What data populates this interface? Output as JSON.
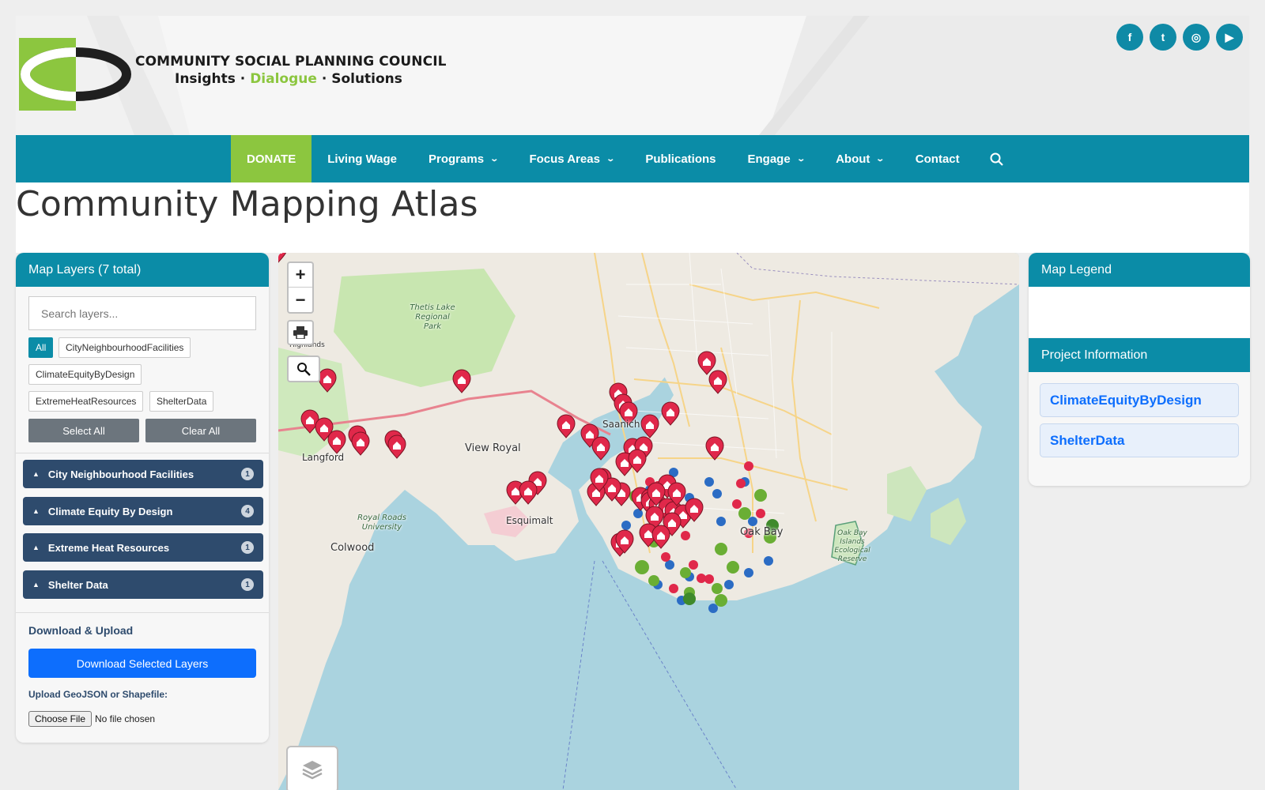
{
  "header": {
    "org_name": "COMMUNITY SOCIAL PLANNING COUNCIL",
    "tagline_part1": "Insights · ",
    "tagline_part2": "Dialogue",
    "tagline_part3": " · Solutions",
    "social": [
      "f",
      "t",
      "◎",
      "▶"
    ],
    "social_icons": [
      "facebook-icon",
      "twitter-icon",
      "instagram-icon",
      "youtube-icon"
    ]
  },
  "nav": {
    "items": [
      "DONATE",
      "Living Wage",
      "Programs",
      "Focus Areas",
      "Publications",
      "Engage",
      "About",
      "Contact"
    ],
    "has_dropdown": [
      false,
      false,
      true,
      true,
      false,
      true,
      true,
      false
    ]
  },
  "page": {
    "title": "Community Mapping Atlas"
  },
  "layers_panel": {
    "header": "Map Layers (7 total)",
    "search_placeholder": "Search layers...",
    "filters": [
      "All",
      "CityNeighbourhoodFacilities",
      "ClimateEquityByDesign",
      "ExtremeHeatResources",
      "ShelterData"
    ],
    "active_filter": "All",
    "select_all": "Select All",
    "clear_all": "Clear All",
    "groups": [
      {
        "name": "City Neighbourhood Facilities",
        "count": "1"
      },
      {
        "name": "Climate Equity By Design",
        "count": "4"
      },
      {
        "name": "Extreme Heat Resources",
        "count": "1"
      },
      {
        "name": "Shelter Data",
        "count": "1"
      }
    ],
    "download_heading": "Download & Upload",
    "download_button": "Download Selected Layers",
    "upload_label": "Upload GeoJSON or Shapefile:",
    "choose_file": "Choose File",
    "no_file": "No file chosen"
  },
  "map": {
    "zoom_in": "+",
    "zoom_out": "−",
    "labels": {
      "view_royal": "View Royal",
      "colwood": "Colwood",
      "oak_bay": "Oak Bay",
      "esquimalt": "Esquimalt",
      "langford": "Langford",
      "saanich": "Saanich",
      "highlands": "Highlands",
      "thetis": "Thetis Lake\nRegional\nPark",
      "royal_roads": "Royal Roads\nUniversity",
      "oak_bay_islands": "Oak Bay\nIslands\nEcological\nReserve"
    }
  },
  "legend_panel": {
    "header": "Map Legend",
    "project_header": "Project Information",
    "projects": [
      "ClimateEquityByDesign",
      "ShelterData"
    ]
  },
  "colors": {
    "teal": "#0b8ca7",
    "green": "#8cc63f",
    "navy": "#2e4b6d",
    "blue": "#0d6efd",
    "marker_red": "#e0284a",
    "dot_blue": "#2b6cc4",
    "dot_green": "#6aae34"
  }
}
